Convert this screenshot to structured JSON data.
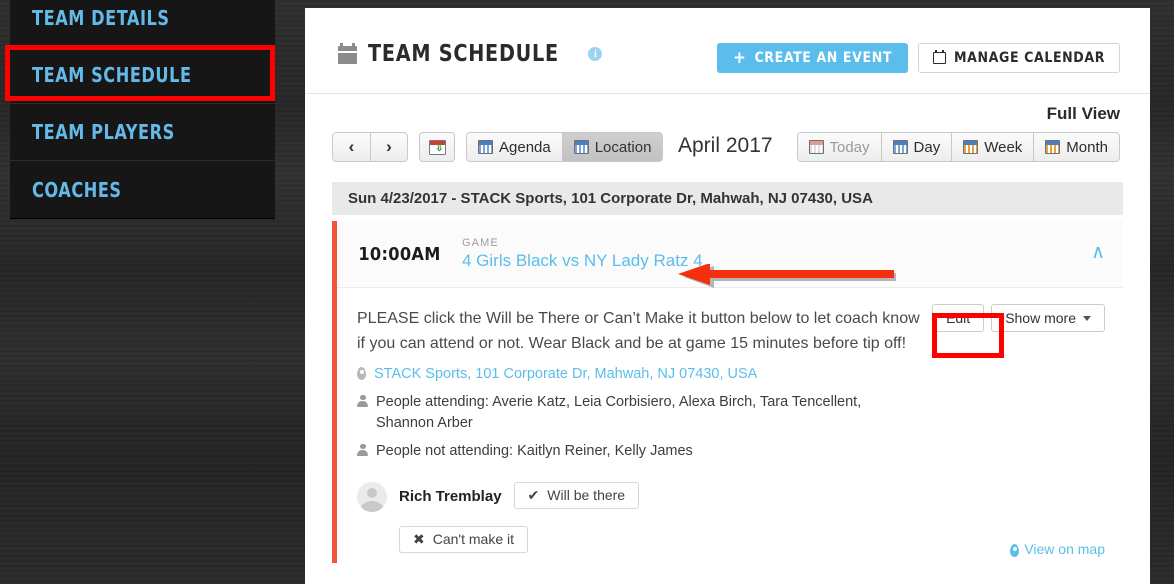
{
  "colors": {
    "accent_blue": "#5bbdec",
    "sidebar_link": "#63b9e8",
    "event_stripe": "#f1543f",
    "annotation_red": "#ff0000",
    "sidebar_bg": "#161616",
    "panel_bg": "#ffffff"
  },
  "sidebar": {
    "items": [
      {
        "label": "Team Details",
        "selected": false
      },
      {
        "label": "Team Schedule",
        "selected": true
      },
      {
        "label": "Team Players",
        "selected": false
      },
      {
        "label": "Coaches",
        "selected": false
      }
    ]
  },
  "header": {
    "calendar_icon": "calendar-icon",
    "title": "Team Schedule",
    "info_icon": "i",
    "create_event_button": "Create an Event",
    "create_event_plus": "+",
    "manage_calendar_button": "Manage Calendar"
  },
  "toolbar": {
    "prev_label": "‹",
    "next_label": "›",
    "export_icon": "calendar-export-icon",
    "views": [
      {
        "label": "Agenda",
        "icon": "calendar-icon",
        "active": false
      },
      {
        "label": "Location",
        "icon": "calendar-icon",
        "active": true
      }
    ],
    "month_label": "April 2017",
    "full_view_label": "Full View",
    "ranges": [
      {
        "label": "Today",
        "icon": "calendar-icon",
        "disabled": true
      },
      {
        "label": "Day",
        "icon": "calendar-icon",
        "disabled": false
      },
      {
        "label": "Week",
        "icon": "calendar-icon",
        "disabled": false
      },
      {
        "label": "Month",
        "icon": "calendar-icon",
        "disabled": false
      }
    ]
  },
  "schedule": {
    "day_header": "Sun 4/23/2017 - STACK Sports, 101 Corporate Dr, Mahwah, NJ 07430, USA",
    "event": {
      "time": "10:00AM",
      "kind": "GAME",
      "title": "4 Girls Black vs NY Lady Ratz 4",
      "collapse_icon": "∧",
      "description": "PLEASE click the Will be There or Can’t Make it button below to let coach know if you can attend or not. Wear Black and be at game 15 minutes before tip off!",
      "edit_button": "Edit",
      "show_more_button": "Show more",
      "location_link": "STACK Sports, 101 Corporate Dr, Mahwah, NJ 07430, USA",
      "attending_line": "People attending: Averie Katz, Leia Corbisiero, Alexa Birch, Tara Tencellent, Shannon Arber",
      "not_attending_line": "People not attending: Kaitlyn Reiner, Kelly James",
      "rsvp_user": "Rich Tremblay",
      "rsvp_yes": "Will be there",
      "rsvp_yes_icon": "✔",
      "rsvp_no": "Can't make it",
      "rsvp_no_icon": "✖",
      "view_on_map": "View on map"
    }
  },
  "annotations": {
    "sidebar_box": "red-highlight-box-team-schedule",
    "edit_box": "red-highlight-box-edit",
    "arrow": "red-arrow-pointing-to-event-title"
  }
}
